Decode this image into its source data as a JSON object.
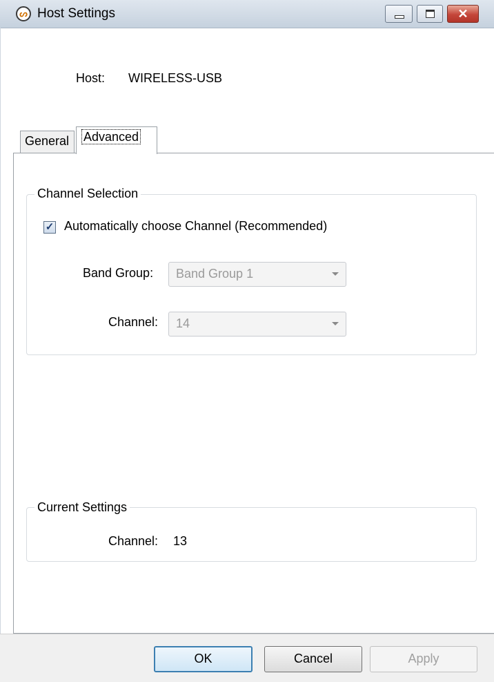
{
  "window": {
    "title": "Host Settings",
    "icon": "app-signal-icon",
    "icon_glyph": "ᔕ",
    "controls": {
      "close_glyph": "✕"
    }
  },
  "host": {
    "label": "Host:",
    "value": "WIRELESS-USB"
  },
  "tabs": [
    {
      "label": "General",
      "selected": false
    },
    {
      "label": "Advanced",
      "selected": true
    }
  ],
  "channel_selection": {
    "title": "Channel Selection",
    "auto_checkbox": {
      "label": "Automatically choose Channel (Recommended)",
      "checked": true,
      "glyph": "✓"
    },
    "band_group": {
      "label": "Band Group:",
      "value": "Band Group 1",
      "enabled": false
    },
    "channel": {
      "label": "Channel:",
      "value": "14",
      "enabled": false
    }
  },
  "current_settings": {
    "title": "Current Settings",
    "channel_label": "Channel:",
    "channel_value": "13"
  },
  "buttons": {
    "ok": "OK",
    "cancel": "Cancel",
    "apply": "Apply"
  },
  "colors": {
    "title_bar": "#c5d1de",
    "close_button": "#c4463a",
    "default_button_border": "#3c7fb1",
    "disabled_text": "#9a9a9a"
  }
}
